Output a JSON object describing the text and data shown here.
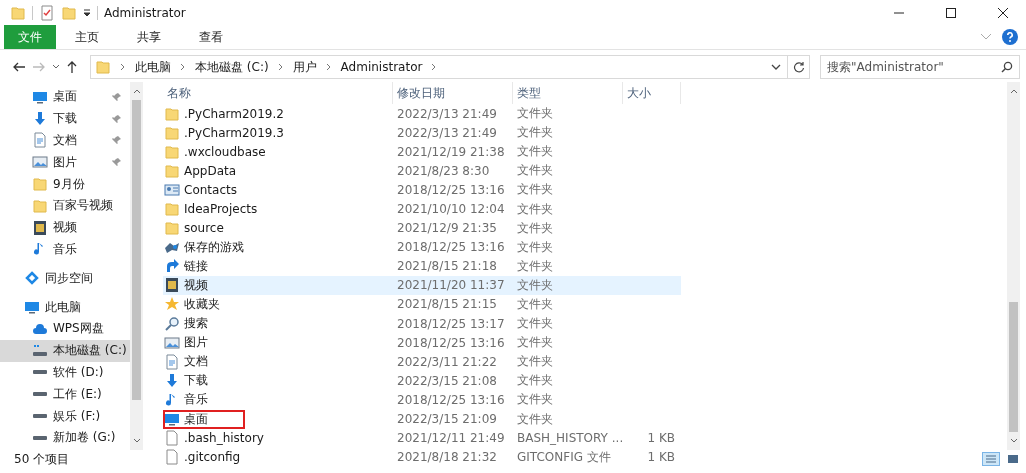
{
  "window": {
    "title": "Administrator"
  },
  "ribbon_tabs": [
    {
      "label": "文件",
      "kind": "file",
      "selected": false
    },
    {
      "label": "主页",
      "kind": "tab",
      "selected": false
    },
    {
      "label": "共享",
      "kind": "tab",
      "selected": false
    },
    {
      "label": "查看",
      "kind": "tab",
      "selected": false
    }
  ],
  "address_bar": {
    "crumbs": [
      "此电脑",
      "本地磁盘 (C:)",
      "用户",
      "Administrator"
    ]
  },
  "search": {
    "placeholder": "搜索\"Administrator\""
  },
  "sidebar": {
    "quick_access": [
      {
        "label": "桌面",
        "kind": "desktop",
        "pinned": true
      },
      {
        "label": "下载",
        "kind": "download",
        "pinned": true
      },
      {
        "label": "文档",
        "kind": "doc",
        "pinned": true
      },
      {
        "label": "图片",
        "kind": "picture",
        "pinned": true
      },
      {
        "label": "9月份",
        "kind": "folder",
        "pinned": false
      },
      {
        "label": "百家号视频",
        "kind": "folder",
        "pinned": false
      },
      {
        "label": "视频",
        "kind": "video",
        "pinned": false
      },
      {
        "label": "音乐",
        "kind": "music",
        "pinned": false
      }
    ],
    "items": [
      {
        "label": "同步空间",
        "kind": "sync",
        "selected": false
      },
      {
        "label": "此电脑",
        "kind": "pc",
        "selected": false,
        "children": [
          {
            "label": "WPS网盘",
            "kind": "cloud",
            "selected": false
          },
          {
            "label": "本地磁盘 (C:)",
            "kind": "sysdrive",
            "selected": true
          },
          {
            "label": "软件 (D:)",
            "kind": "drive",
            "selected": false
          },
          {
            "label": "工作 (E:)",
            "kind": "drive",
            "selected": false
          },
          {
            "label": "娱乐 (F:)",
            "kind": "drive",
            "selected": false
          },
          {
            "label": "新加卷 (G:)",
            "kind": "drive",
            "selected": false
          }
        ]
      }
    ]
  },
  "table": {
    "columns": [
      "名称",
      "修改日期",
      "类型",
      "大小"
    ],
    "rows": [
      {
        "name": ".PyCharm2019.2",
        "date": "2022/3/13 21:49",
        "type": "文件夹",
        "kind": "folder",
        "selected": false,
        "marked": false
      },
      {
        "name": ".PyCharm2019.3",
        "date": "2022/3/13 21:49",
        "type": "文件夹",
        "kind": "folder",
        "selected": false,
        "marked": false
      },
      {
        "name": ".wxcloudbase",
        "date": "2021/12/19 21:38",
        "type": "文件夹",
        "kind": "folder",
        "selected": false,
        "marked": false
      },
      {
        "name": "AppData",
        "date": "2021/8/23 8:30",
        "type": "文件夹",
        "kind": "folder",
        "selected": false,
        "marked": false
      },
      {
        "name": "Contacts",
        "date": "2018/12/25 13:16",
        "type": "文件夹",
        "kind": "contacts",
        "selected": false,
        "marked": false
      },
      {
        "name": "IdeaProjects",
        "date": "2021/10/10 12:04",
        "type": "文件夹",
        "kind": "folder",
        "selected": false,
        "marked": false
      },
      {
        "name": "source",
        "date": "2021/12/9 21:35",
        "type": "文件夹",
        "kind": "folder",
        "selected": false,
        "marked": false
      },
      {
        "name": "保存的游戏",
        "date": "2018/12/25 13:16",
        "type": "文件夹",
        "kind": "games",
        "selected": false,
        "marked": false
      },
      {
        "name": "链接",
        "date": "2021/8/15 21:18",
        "type": "文件夹",
        "kind": "link",
        "selected": false,
        "marked": false
      },
      {
        "name": "视频",
        "date": "2021/11/20 11:37",
        "type": "文件夹",
        "kind": "video",
        "selected": true,
        "marked": false
      },
      {
        "name": "收藏夹",
        "date": "2021/8/15 21:15",
        "type": "文件夹",
        "kind": "star",
        "selected": false,
        "marked": false
      },
      {
        "name": "搜索",
        "date": "2018/12/25 13:17",
        "type": "文件夹",
        "kind": "search",
        "selected": false,
        "marked": false
      },
      {
        "name": "图片",
        "date": "2018/12/25 13:16",
        "type": "文件夹",
        "kind": "picture",
        "selected": false,
        "marked": false
      },
      {
        "name": "文档",
        "date": "2022/3/11 21:22",
        "type": "文件夹",
        "kind": "doc",
        "selected": false,
        "marked": false
      },
      {
        "name": "下载",
        "date": "2022/3/15 21:08",
        "type": "文件夹",
        "kind": "download",
        "selected": false,
        "marked": false
      },
      {
        "name": "音乐",
        "date": "2018/12/25 13:16",
        "type": "文件夹",
        "kind": "music",
        "selected": false,
        "marked": false
      },
      {
        "name": "桌面",
        "date": "2022/3/15 21:09",
        "type": "文件夹",
        "kind": "desktop",
        "selected": false,
        "marked": true
      },
      {
        "name": ".bash_history",
        "date": "2021/12/11 21:49",
        "type": "BASH_HISTORY ...",
        "size": "1 KB",
        "kind": "file",
        "selected": false,
        "marked": false
      },
      {
        "name": ".gitconfig",
        "date": "2021/8/18 21:32",
        "type": "GITCONFIG 文件",
        "size": "1 KB",
        "kind": "file",
        "selected": false,
        "marked": false
      }
    ]
  },
  "status_bar": {
    "item_count": "50 个项目",
    "views": [
      {
        "kind": "details",
        "selected": true
      },
      {
        "kind": "large",
        "selected": false
      }
    ]
  }
}
